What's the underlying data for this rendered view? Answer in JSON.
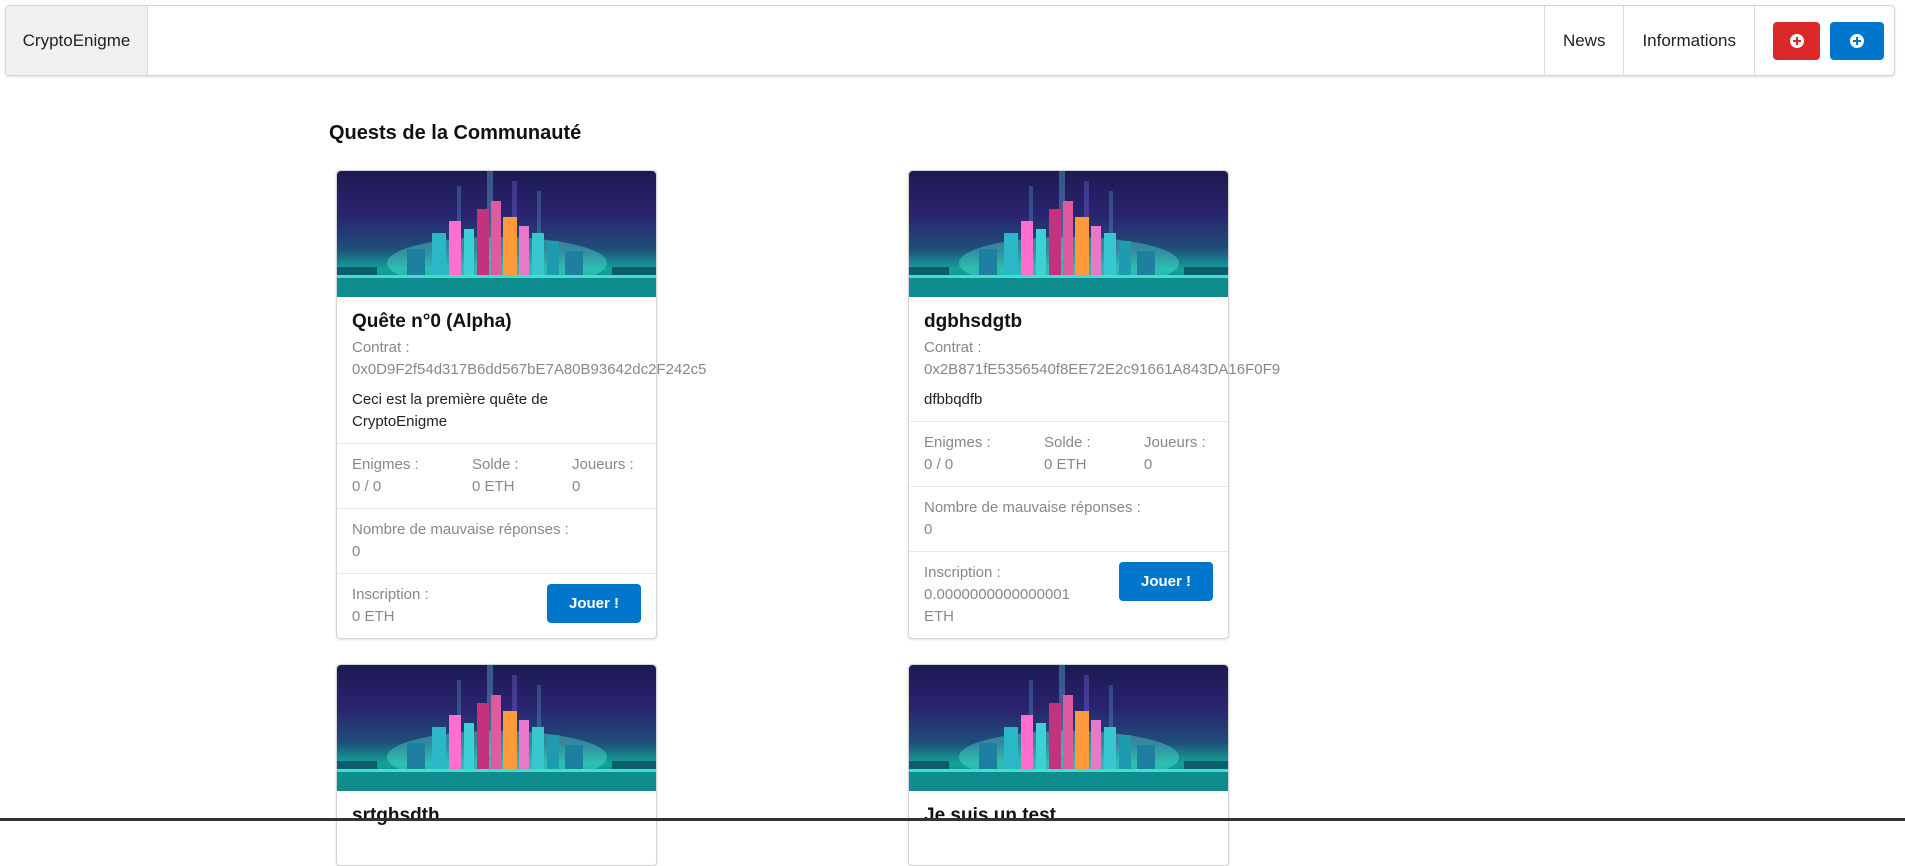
{
  "navbar": {
    "brand": "CryptoEnigme",
    "links": [
      "News",
      "Informations"
    ]
  },
  "page": {
    "title": "Quests de la Communauté"
  },
  "labels": {
    "contract": "Contrat :",
    "enigmes": "Enigmes :",
    "solde": "Solde :",
    "joueurs": "Joueurs :",
    "bad_answers": "Nombre de mauvaise réponses :",
    "inscription": "Inscription :",
    "play": "Jouer !"
  },
  "quests": [
    {
      "title": "Quête n°0 (Alpha)",
      "contract": "0x0D9F2f54d317B6dd567bE7A80B93642dc2F242c5",
      "description": "Ceci est la première quête de CryptoEnigme",
      "enigmes": "0 / 0",
      "solde": "0 ETH",
      "joueurs": "0",
      "bad_answers": "0",
      "inscription": "0 ETH"
    },
    {
      "title": "dgbhsdgtb",
      "contract": "0x2B871fE5356540f8EE72E2c91661A843DA16F0F9",
      "description": "dfbbqdfb",
      "enigmes": "0 / 0",
      "solde": "0 ETH",
      "joueurs": "0",
      "bad_answers": "0",
      "inscription": "0.0000000000000001 ETH"
    },
    {
      "title": "srtghsdth"
    },
    {
      "title": "Je suis un test"
    }
  ],
  "colors": {
    "primary": "#0077cc",
    "danger": "#db2828"
  }
}
